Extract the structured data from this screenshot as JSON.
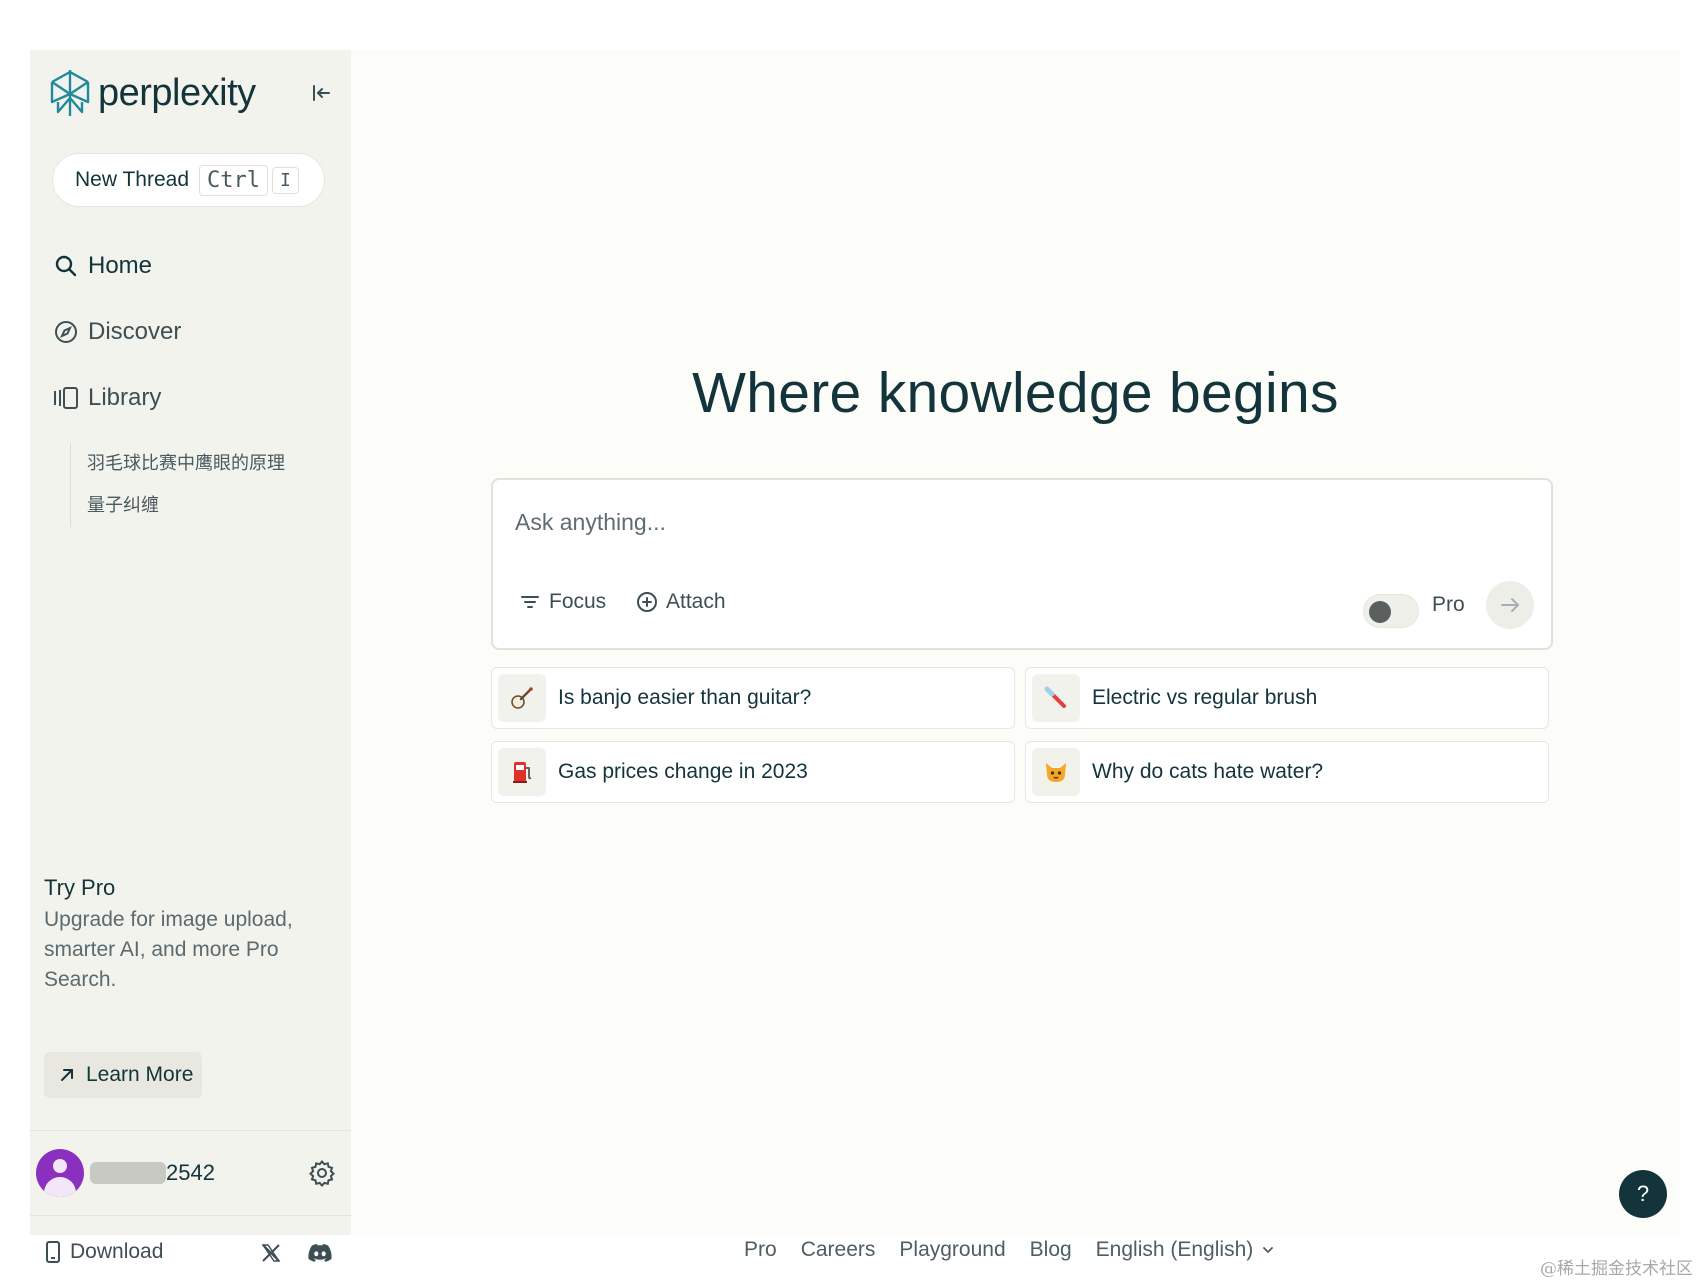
{
  "app": {
    "brand": "perplexity",
    "accent_color": "#13343b",
    "pro_toggle_color": "#5a5f60"
  },
  "sidebar": {
    "collapse_icon": "collapse-left-icon",
    "new_thread": {
      "label": "New Thread",
      "shortcut_key1": "Ctrl",
      "shortcut_key2": "I"
    },
    "nav": [
      {
        "label": "Home",
        "icon": "search-icon"
      },
      {
        "label": "Discover",
        "icon": "compass-icon"
      },
      {
        "label": "Library",
        "icon": "library-icon"
      }
    ],
    "library_items": [
      "羽毛球比赛中鹰眼的原理",
      "量子纠缠"
    ],
    "try_pro": {
      "title": "Try Pro",
      "description": "Upgrade for image upload, smarter AI, and more Pro Search.",
      "learn_more": "Learn More"
    },
    "user": {
      "name_suffix": "2542",
      "avatar_color": "#8b2fbf"
    },
    "download": "Download"
  },
  "main": {
    "headline": "Where knowledge begins",
    "composer": {
      "placeholder": "Ask anything...",
      "focus": "Focus",
      "attach": "Attach",
      "pro_label": "Pro"
    },
    "suggestions": [
      {
        "text": "Is banjo easier than guitar?",
        "icon": "banjo-icon"
      },
      {
        "text": "Electric vs regular brush",
        "icon": "toothbrush-icon"
      },
      {
        "text": "Gas prices change in 2023",
        "icon": "fuel-pump-icon"
      },
      {
        "text": "Why do cats hate water?",
        "icon": "cat-face-icon"
      }
    ]
  },
  "footer": {
    "links": [
      "Pro",
      "Careers",
      "Playground",
      "Blog"
    ],
    "language": "English (English)"
  },
  "help_label": "?",
  "watermark": "@稀土掘金技术社区"
}
